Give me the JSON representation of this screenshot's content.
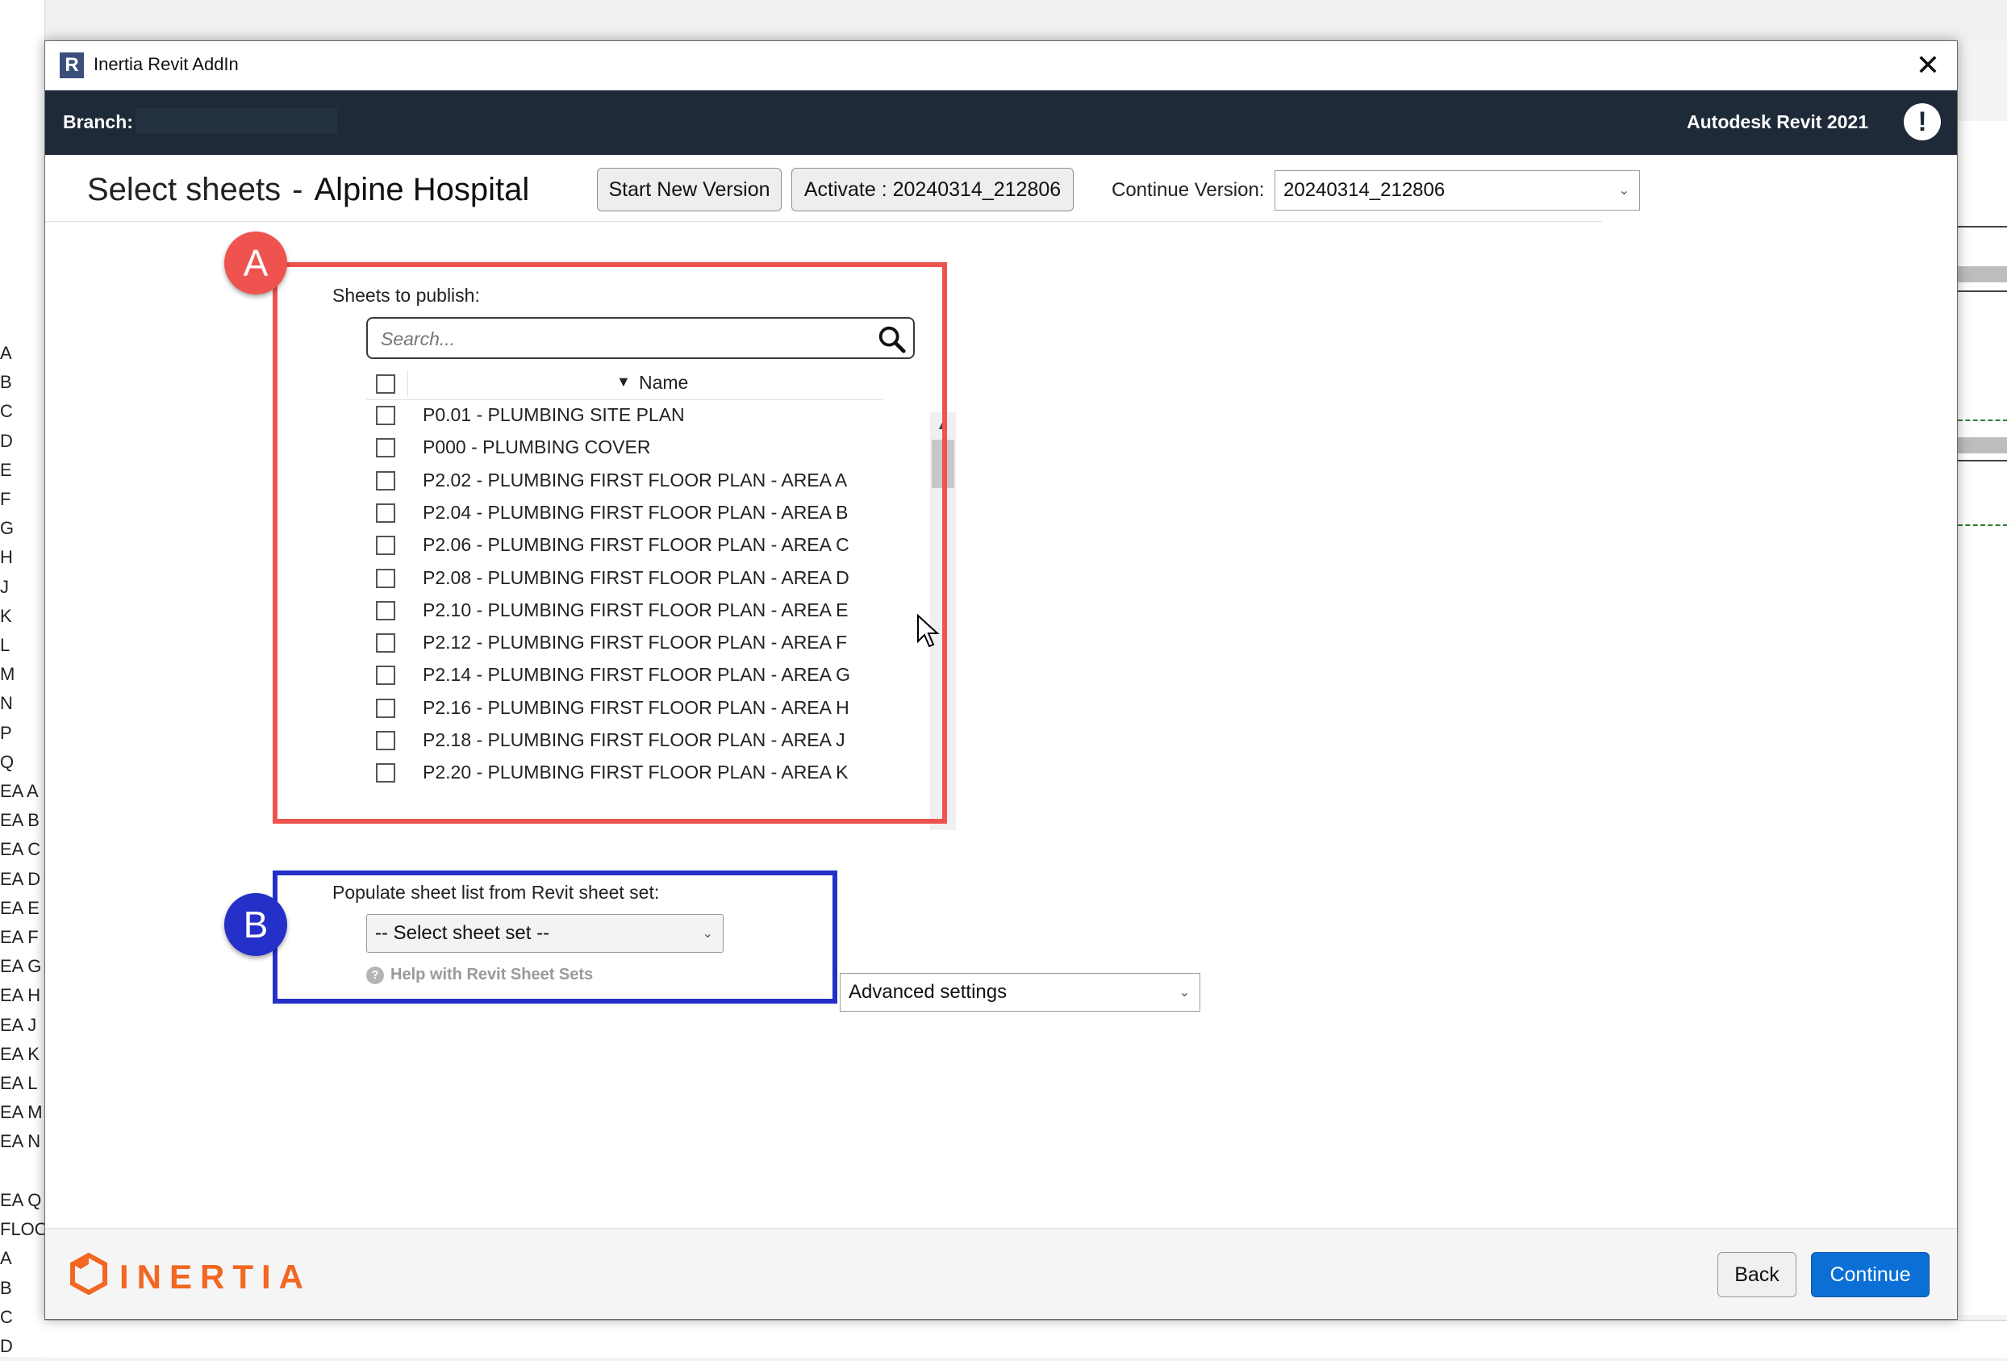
{
  "window": {
    "title": "Inertia Revit AddIn",
    "app_icon": "R"
  },
  "header": {
    "branch_label": "Branch:",
    "product": "Autodesk Revit 2021",
    "alert_icon": "!"
  },
  "page": {
    "title": "Select sheets",
    "separator": "-",
    "project": "Alpine Hospital"
  },
  "toolbar": {
    "start_new_version": "Start New Version",
    "activate": "Activate : 20240314_212806",
    "continue_label": "Continue Version:",
    "continue_value": "20240314_212806"
  },
  "annotations": {
    "a": "A",
    "b": "B",
    "a_color": "#ef5350",
    "b_color": "#2430c7"
  },
  "sheets": {
    "label": "Sheets to publish:",
    "search_placeholder": "Search...",
    "column_name": "Name",
    "rows": [
      "P0.01 - PLUMBING SITE PLAN",
      "P000 - PLUMBING COVER",
      "P2.02 - PLUMBING FIRST FLOOR PLAN - AREA A",
      "P2.04 - PLUMBING FIRST FLOOR PLAN - AREA B",
      "P2.06 - PLUMBING FIRST FLOOR PLAN - AREA C",
      "P2.08 - PLUMBING FIRST FLOOR PLAN - AREA D",
      "P2.10 - PLUMBING FIRST FLOOR PLAN - AREA E",
      "P2.12 - PLUMBING FIRST FLOOR PLAN - AREA F",
      "P2.14 - PLUMBING FIRST FLOOR PLAN - AREA G",
      "P2.16 - PLUMBING FIRST FLOOR PLAN - AREA H",
      "P2.18 - PLUMBING FIRST FLOOR PLAN - AREA J",
      "P2.20 - PLUMBING FIRST FLOOR PLAN - AREA K"
    ]
  },
  "sheet_set": {
    "label": "Populate sheet list from Revit sheet set:",
    "placeholder": "-- Select sheet set --",
    "help": "Help with Revit Sheet Sets"
  },
  "advanced": {
    "label": "Advanced settings"
  },
  "footer": {
    "logo": "INERTIA",
    "back": "Back",
    "continue": "Continue",
    "accent": "#0b6fd6",
    "brand": "#f26722"
  },
  "background": {
    "left_letters": [
      "A",
      "B",
      "C",
      "D",
      "E",
      "F",
      "G",
      "H",
      "J",
      "K",
      "L",
      "M",
      "N",
      "P",
      "Q",
      "EA A",
      "EA B",
      "EA C",
      "EA D",
      "EA E",
      "EA F",
      "EA G",
      "EA H",
      "EA J",
      "EA K",
      "EA L",
      "EA M",
      "EA N",
      "",
      "EA Q",
      "FLOO",
      "A",
      "B",
      "C",
      "D"
    ]
  }
}
